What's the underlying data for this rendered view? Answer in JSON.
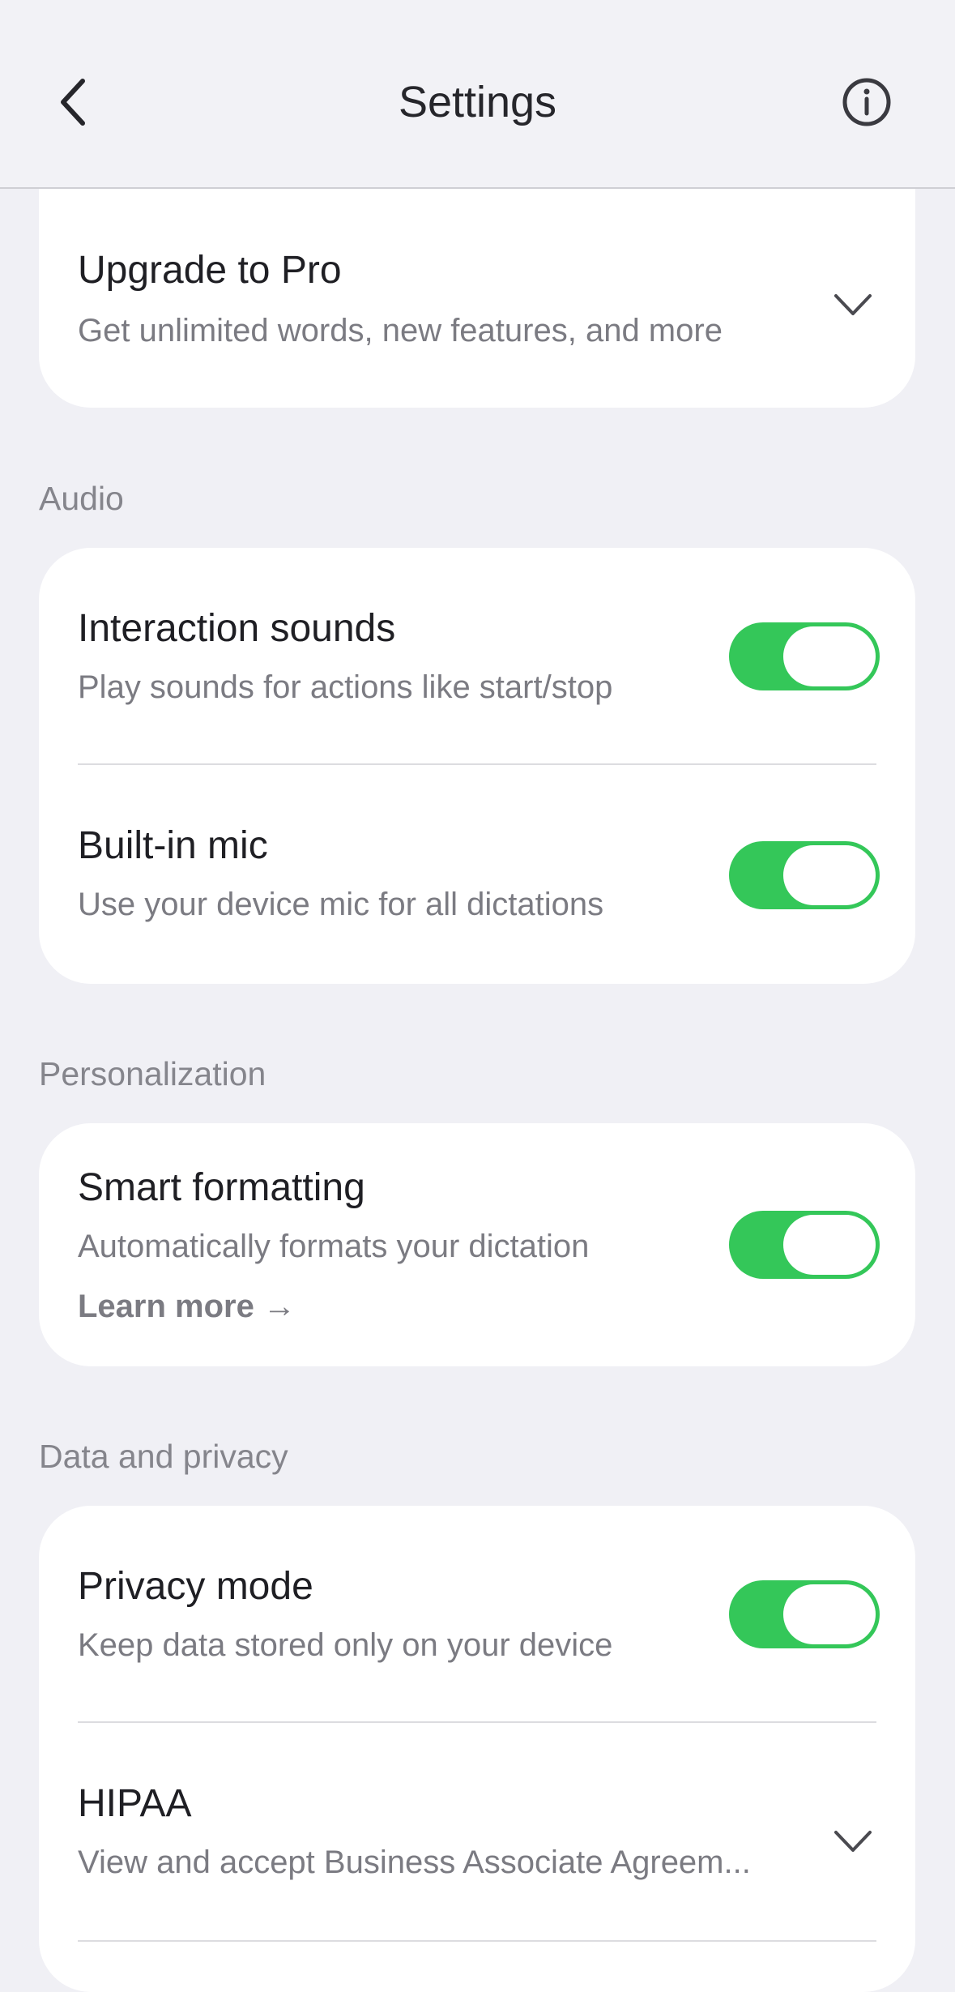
{
  "header": {
    "title": "Settings",
    "back_icon": "chevron-left-icon",
    "info_icon": "info-circle-icon"
  },
  "upgrade": {
    "title": "Upgrade to Pro",
    "description": "Get unlimited words, new features, and more",
    "icon": "chevron-down-icon"
  },
  "audio": {
    "section_label": "Audio",
    "interaction_sounds": {
      "title": "Interaction sounds",
      "description": "Play sounds for actions like start/stop",
      "enabled": true
    },
    "builtin_mic": {
      "title": "Built-in mic",
      "description": "Use your device mic for all dictations",
      "enabled": true
    }
  },
  "personalization": {
    "section_label": "Personalization",
    "smart_formatting": {
      "title": "Smart formatting",
      "description": "Automatically formats your dictation",
      "link": "Learn more →",
      "enabled": true
    }
  },
  "privacy": {
    "section_label": "Data and privacy",
    "privacy_mode": {
      "title": "Privacy mode",
      "description": "Keep data stored only on your device",
      "enabled": true
    },
    "hipaa": {
      "title": "HIPAA",
      "description": "View and accept Business Associate Agreem...",
      "icon": "chevron-down-icon"
    }
  },
  "colors": {
    "toggle_on": "#34c759",
    "background": "#f0f0f5",
    "card": "#ffffff"
  }
}
